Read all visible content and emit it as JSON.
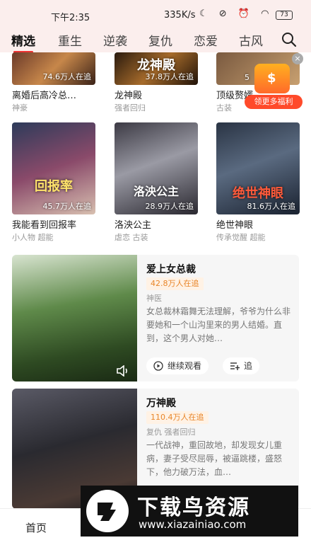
{
  "status": {
    "time": "下午2:35",
    "speed": "335K/s",
    "battery": "73"
  },
  "tabs": [
    {
      "label": "精选"
    },
    {
      "label": "重生"
    },
    {
      "label": "逆袭"
    },
    {
      "label": "复仇"
    },
    {
      "label": "恋爱"
    },
    {
      "label": "古风"
    }
  ],
  "row1": [
    {
      "title": "离婚后高冷总…",
      "watchers": "74.6万人在追",
      "tags": "神豪",
      "cover_text": ""
    },
    {
      "title": "龙神殿",
      "watchers": "37.8万人在追",
      "tags": "强者回归",
      "cover_text": "龙神殿"
    },
    {
      "title": "顶级赘婿",
      "watchers": "5",
      "tags": "古装",
      "cover_text": ""
    }
  ],
  "promo": {
    "label": "领更多福利"
  },
  "row2": [
    {
      "title": "我能看到回报率",
      "watchers": "45.7万人在追",
      "tags": "小人物 超能",
      "cover_text": "回报率"
    },
    {
      "title": "洛泱公主",
      "watchers": "28.9万人在追",
      "tags": "虐恋 古装",
      "cover_text": "洛泱公主"
    },
    {
      "title": "绝世神眼",
      "watchers": "81.6万人在追",
      "tags": "传承觉醒 超能",
      "cover_text": "绝世神眼"
    }
  ],
  "items": [
    {
      "title": "爱上女总裁",
      "watchers": "42.8万人在追",
      "tags": "神医",
      "desc": "女总裁林霜舞无法理解，爷爷为什么非要她和一个山沟里来的男人结婚。直到，这个男人对她…",
      "continue_label": "继续观看",
      "follow_label": "追"
    },
    {
      "title": "万神殿",
      "watchers": "110.4万人在追",
      "tags": "复仇  强者回归",
      "desc": "一代战神，重回故地，却发现女儿重病，妻子受尽屈辱，被逼跳楼，盛怒下，他力破万法，血…"
    }
  ],
  "nav": {
    "home": "首页"
  },
  "watermark": {
    "title": "下载鸟资源",
    "url": "www.xiazainiao.com"
  },
  "colors": {
    "accent": "#e33333",
    "header_bg": "#fbeeed",
    "watch_tag": "#e8862a"
  }
}
